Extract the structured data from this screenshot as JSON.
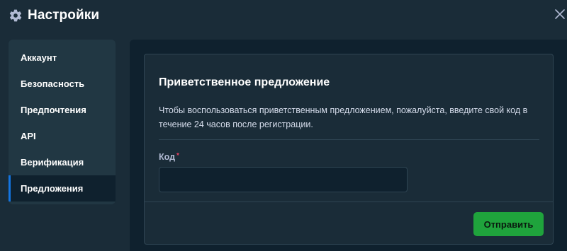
{
  "header": {
    "title": "Настройки",
    "icon": "gear-icon",
    "close_icon": "close-icon"
  },
  "sidebar": {
    "items": [
      {
        "label": "Аккаунт",
        "active": false
      },
      {
        "label": "Безопасность",
        "active": false
      },
      {
        "label": "Предпочтения",
        "active": false
      },
      {
        "label": "API",
        "active": false
      },
      {
        "label": "Верификация",
        "active": false
      },
      {
        "label": "Предложения",
        "active": true
      }
    ]
  },
  "offer": {
    "title": "Приветственное предложение",
    "description": "Чтобы воспользоваться приветственным предложением, пожалуйста, введите свой код в течение 24 часов после регистрации.",
    "code_label": "Код",
    "required_marker": "*",
    "code_value": "",
    "submit_label": "Отправить"
  },
  "colors": {
    "background": "#1a2c38",
    "panel": "#0f212e",
    "accent": "#1475e1",
    "submit": "#1fa33c",
    "required": "#ed4163"
  }
}
